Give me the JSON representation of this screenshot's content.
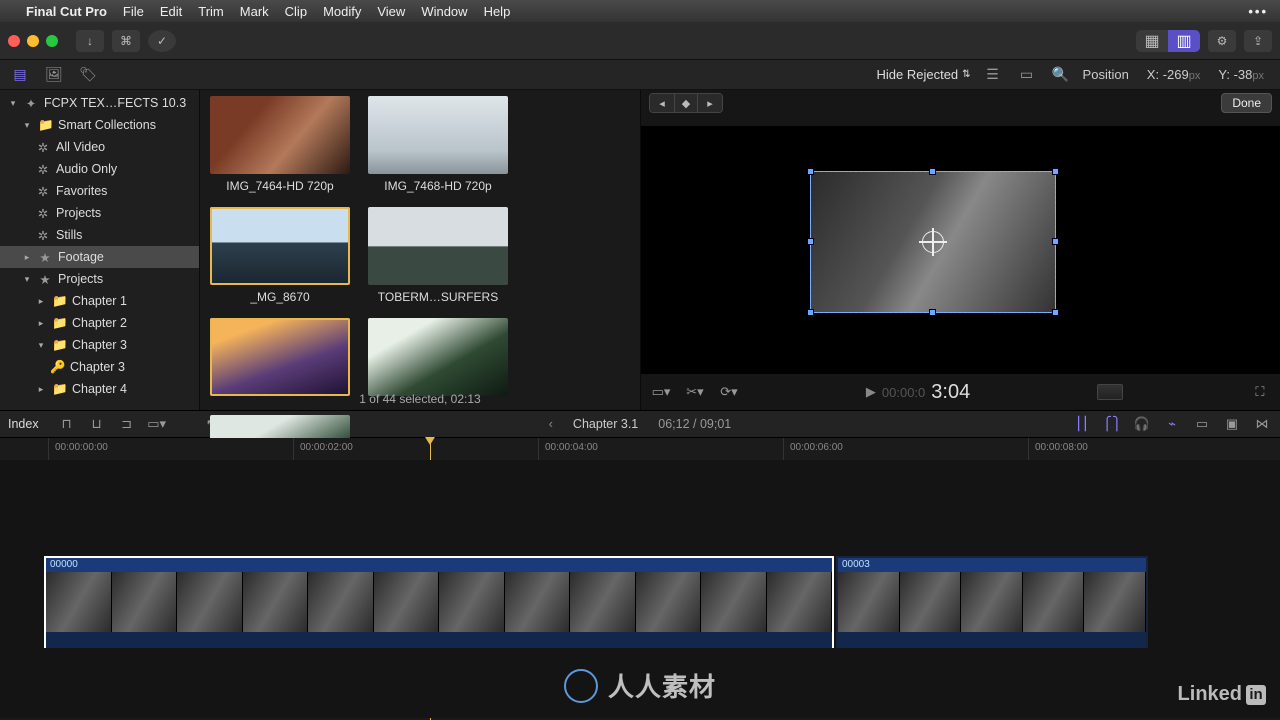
{
  "menubar": {
    "app": "Final Cut Pro",
    "items": [
      "File",
      "Edit",
      "Trim",
      "Mark",
      "Clip",
      "Modify",
      "View",
      "Window",
      "Help"
    ]
  },
  "sidebar": {
    "library": "FCPX TEX…FECTS 10.3",
    "smart": "Smart Collections",
    "smart_items": [
      "All Video",
      "Audio Only",
      "Favorites",
      "Projects",
      "Stills"
    ],
    "footage": "Footage",
    "projects": "Projects",
    "chapters": [
      "Chapter 1",
      "Chapter 2",
      "Chapter 3"
    ],
    "chapter3_child": "Chapter 3",
    "chapter4": "Chapter 4"
  },
  "browser": {
    "hide_rejected": "Hide Rejected",
    "clips": [
      {
        "label": "IMG_7464-HD 720p"
      },
      {
        "label": "IMG_7468-HD 720p"
      },
      {
        "label": "_MG_8670"
      },
      {
        "label": "TOBERM…SURFERS"
      },
      {
        "label": ""
      },
      {
        "label": ""
      },
      {
        "label": ""
      }
    ],
    "status": "1 of 44 selected, 02:13"
  },
  "viewer": {
    "position_label": "Position",
    "x_label": "X:",
    "x_value": "-269",
    "x_unit": "px",
    "y_label": "Y:",
    "y_value": "-38",
    "y_unit": "px",
    "done": "Done",
    "timecode_dim": "00:00:0",
    "timecode": "3:04"
  },
  "timeline_header": {
    "index": "Index",
    "title": "Chapter 3.1",
    "time": "06;12 / 09;01"
  },
  "ruler": [
    "00:00:00:00",
    "00:00:02:00",
    "00:00:04:00",
    "00:00:06:00",
    "00:00:08:00"
  ],
  "timeline_clips": [
    {
      "name": "00000"
    },
    {
      "name": "00003"
    }
  ],
  "watermark": "人人素材",
  "linkedin": "Linked"
}
